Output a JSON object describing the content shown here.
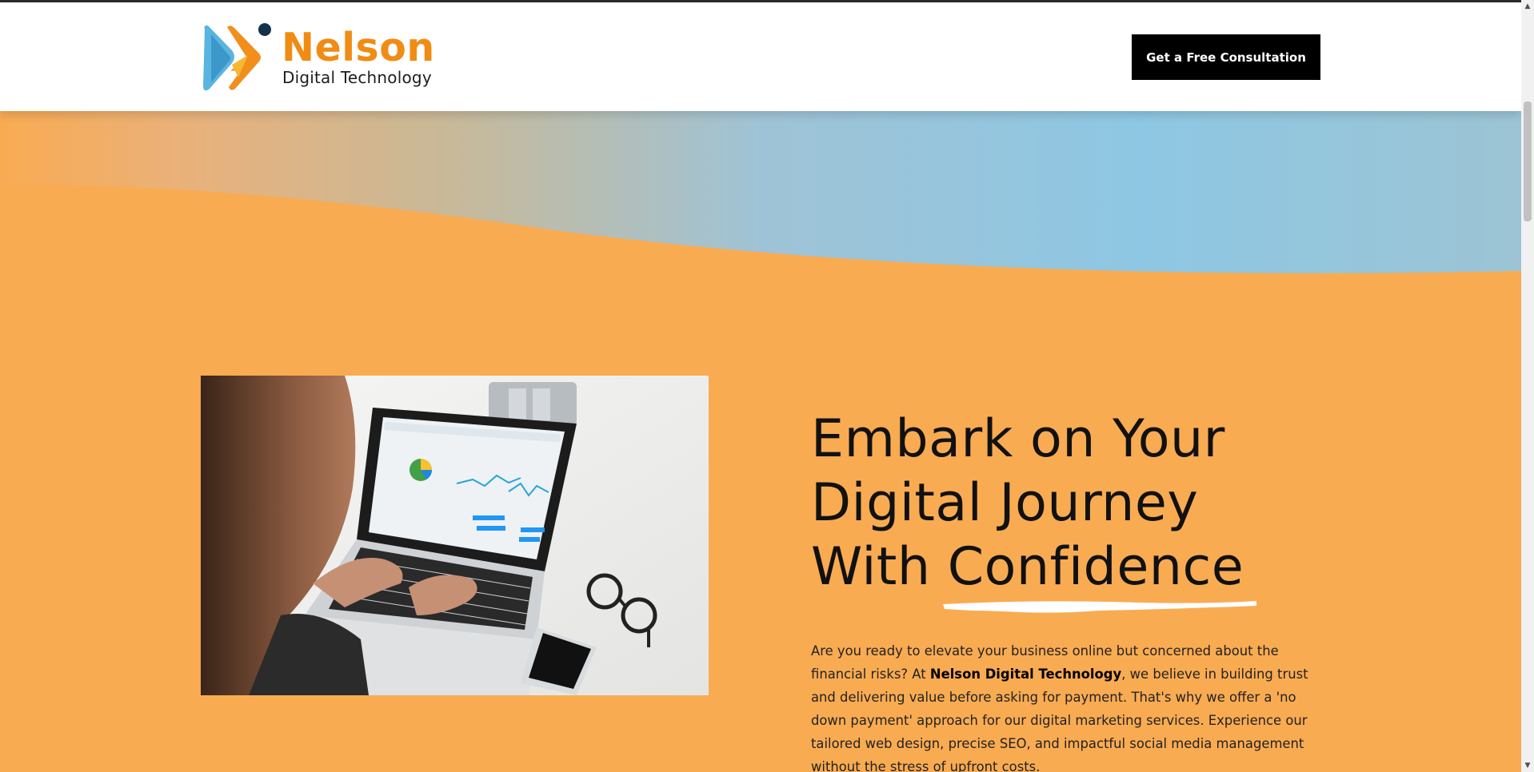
{
  "header": {
    "logo_name": "Nelson",
    "logo_sub": "Digital Technology",
    "cta_label": "Get a Free Consultation"
  },
  "hero": {
    "heading_line1": "Embark on Your",
    "heading_line2": "Digital Journey",
    "heading_line3_prefix": "With",
    "heading_highlight": "Confidence",
    "body_intro": "Are you ready to elevate your business online but concerned about the financial risks? At ",
    "body_brand": "Nelson Digital Technology",
    "body_rest": ", we believe in building trust and delivering value before asking for payment. That's why we offer a 'no down payment' approach for our digital marketing services. Experience our tailored web design, precise SEO, and impactful social media management without the stress of upfront costs.",
    "image_icon": "person-typing-on-laptop-photo"
  },
  "colors": {
    "accent_orange": "#f9ab52",
    "brand_orange": "#f08c14",
    "sky_blue": "#8ec7e3",
    "cta_bg": "#000000"
  }
}
